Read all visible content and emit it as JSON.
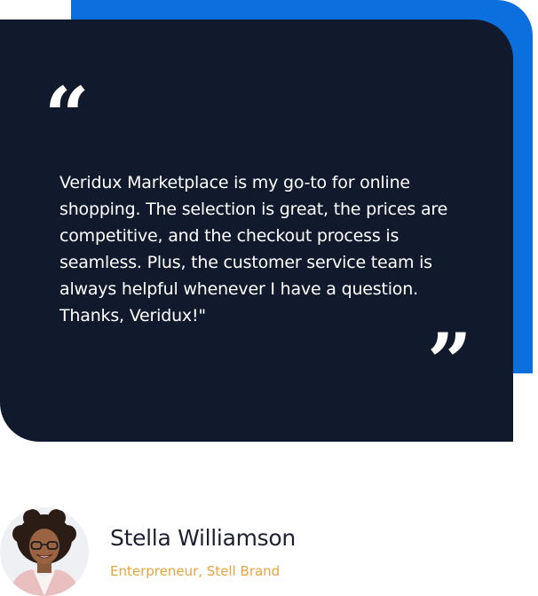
{
  "colors": {
    "accent_blue": "#0c6fde",
    "card_navy": "#111a2c",
    "role_orange": "#e8a33d",
    "text_white": "#ffffff",
    "name_dark": "#1c2132"
  },
  "testimonial": {
    "open_quote": "“",
    "close_quote": "”",
    "quote": "Veridux Marketplace is my go-to for online shopping. The selection is great, the prices are competitive, and the checkout process is seamless. Plus, the customer service team is always helpful whenever I have a question. Thanks, Veridux!\"",
    "open_quote_icon": "quote-open-icon",
    "close_quote_icon": "quote-close-icon"
  },
  "author": {
    "name": "Stella Williamson",
    "role": "Enterpreneur, Stell Brand"
  }
}
